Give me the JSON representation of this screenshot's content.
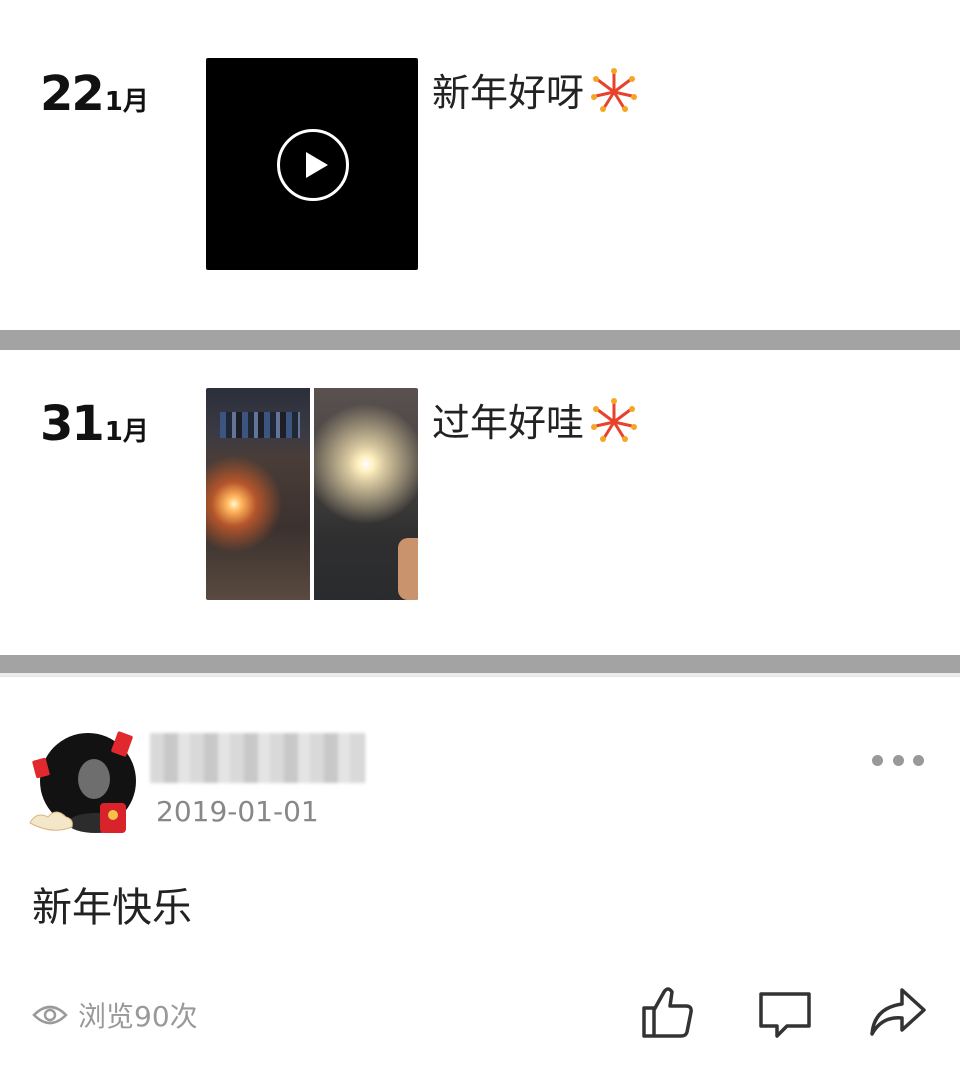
{
  "posts": [
    {
      "day": "22",
      "month": "1月",
      "caption": "新年好呀",
      "caption_emoji": "fireworks-icon",
      "media": "video"
    },
    {
      "day": "31",
      "month": "1月",
      "caption": "过年好哇",
      "caption_emoji": "fireworks-icon",
      "media": "two-photos"
    }
  ],
  "card": {
    "username": "",
    "date": "2019-01-01",
    "content": "新年快乐",
    "views": "浏览90次",
    "actions": [
      "like-icon",
      "comment-icon",
      "share-icon"
    ]
  },
  "colors": {
    "separator": "#a3a3a3",
    "muted": "#999999"
  }
}
